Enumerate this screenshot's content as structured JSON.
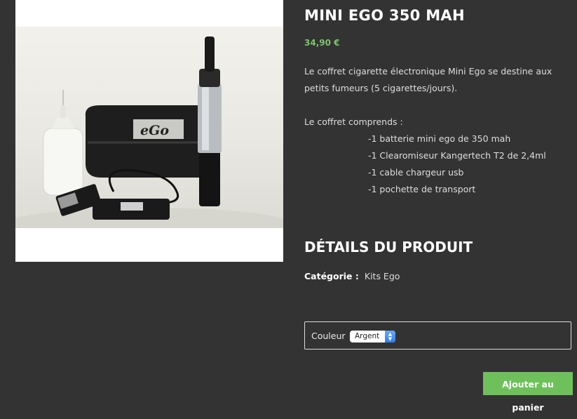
{
  "product": {
    "title": "MINI EGO 350 MAH",
    "price": "34,90 €",
    "description": [
      "Le coffret cigarette électronique Mini Ego se destine aux petits fumeurs (5 cigarettes/jours)."
    ],
    "contents_intro": "Le coffret comprends :",
    "contents": [
      "-1 batterie mini ego de 350 mah",
      "-1 Clearomiseur Kangertech T2 de 2,4ml",
      "-1 cable chargeur usb",
      "-1 pochette de transport"
    ],
    "image_case_logo": "eGo"
  },
  "details": {
    "title": "DÉTAILS DU PRODUIT",
    "category_label": "Catégorie :",
    "category_value": "Kits Ego"
  },
  "variant": {
    "label": "Couleur",
    "selected": "Argent"
  },
  "actions": {
    "add_to_cart": "Ajouter au panier"
  },
  "colors": {
    "background": "#333333",
    "price": "#7cc36b",
    "button": "#6ec15a"
  }
}
